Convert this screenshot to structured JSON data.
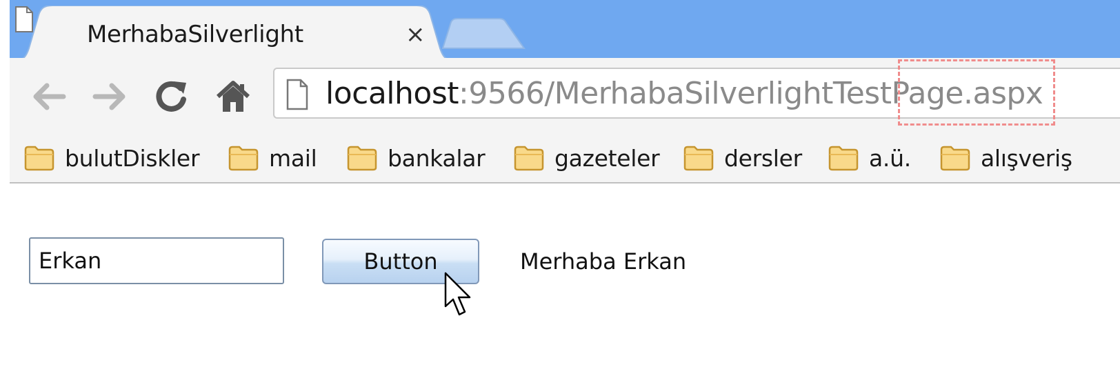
{
  "browser": {
    "tab": {
      "title": "MerhabaSilverlight",
      "close_label": "×"
    },
    "nav": {
      "back_icon": "arrow-left-icon",
      "forward_icon": "arrow-right-icon",
      "reload_icon": "reload-icon",
      "home_icon": "home-icon"
    },
    "address": {
      "host": "localhost",
      "rest": ":9566/MerhabaSilverlightTestPage.aspx"
    },
    "bookmarks": [
      {
        "label": "bulutDiskler"
      },
      {
        "label": "mail"
      },
      {
        "label": "bankalar"
      },
      {
        "label": "gazeteler"
      },
      {
        "label": "dersler"
      },
      {
        "label": "a.ü."
      },
      {
        "label": "alışveriş"
      }
    ]
  },
  "page": {
    "name_input_value": "Erkan",
    "button_label": "Button",
    "output_text": "Merhaba Erkan"
  },
  "colors": {
    "titlebar": "#6fa8f0",
    "toolbar": "#f4f4f4",
    "annotation_dash": "#f08c8c"
  }
}
